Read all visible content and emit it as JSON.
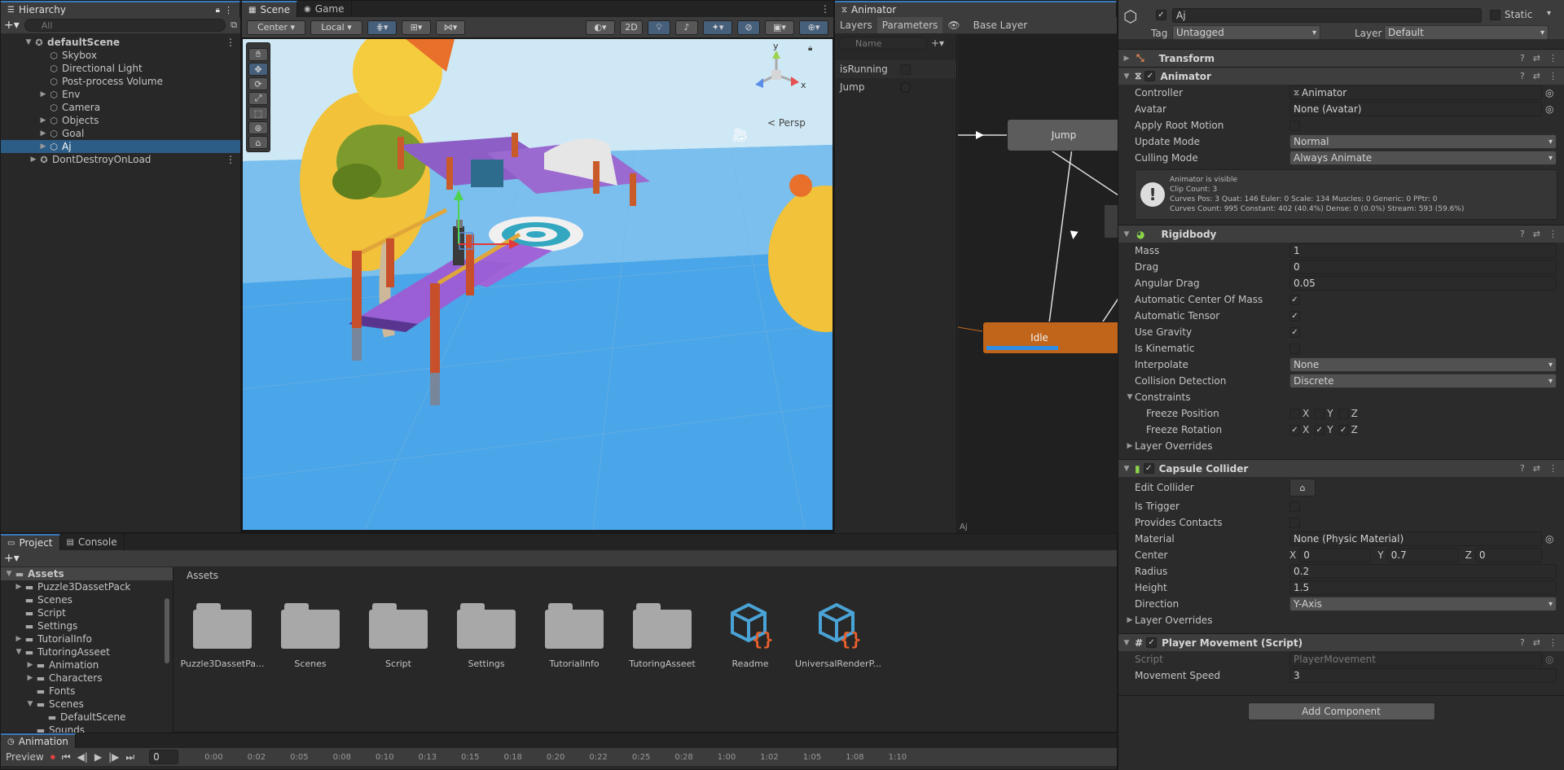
{
  "hierarchy": {
    "tab": "Hierarchy",
    "search_placeholder": "All",
    "items": [
      {
        "label": "defaultScene"
      },
      {
        "label": "Skybox"
      },
      {
        "label": "Directional Light"
      },
      {
        "label": "Post-process Volume"
      },
      {
        "label": "Env"
      },
      {
        "label": "Camera"
      },
      {
        "label": "Objects"
      },
      {
        "label": "Goal"
      },
      {
        "label": "Aj"
      },
      {
        "label": "DontDestroyOnLoad"
      }
    ]
  },
  "scene": {
    "tabs": [
      "Scene",
      "Game"
    ],
    "pivot": "Center",
    "space": "Local",
    "mode_2d": "2D",
    "persp": "< Persp",
    "gizmo_y": "y",
    "gizmo_x": "x"
  },
  "animator": {
    "tab": "Animator",
    "subtabs": [
      "Layers",
      "Parameters"
    ],
    "search_placeholder": "Name",
    "params": [
      {
        "label": "isRunning"
      },
      {
        "label": "Jump"
      }
    ],
    "breadcrumb": "Base Layer",
    "states": {
      "jump": "Jump",
      "idle": "Idle"
    },
    "footer": "Aj"
  },
  "project": {
    "tabs": [
      "Project",
      "Console"
    ],
    "tree": [
      {
        "label": "Assets"
      },
      {
        "label": "Puzzle3DassetPack"
      },
      {
        "label": "Scenes"
      },
      {
        "label": "Script"
      },
      {
        "label": "Settings"
      },
      {
        "label": "TutorialInfo"
      },
      {
        "label": "TutoringAsseet"
      },
      {
        "label": "Animation"
      },
      {
        "label": "Characters"
      },
      {
        "label": "Fonts"
      },
      {
        "label": "Scenes"
      },
      {
        "label": "DefaultScene"
      },
      {
        "label": "Sounds"
      }
    ],
    "breadcrumb": "Assets",
    "assets": [
      {
        "label": "Puzzle3DassetPa...",
        "kind": "folder"
      },
      {
        "label": "Scenes",
        "kind": "folder"
      },
      {
        "label": "Script",
        "kind": "folder"
      },
      {
        "label": "Settings",
        "kind": "folder"
      },
      {
        "label": "TutorialInfo",
        "kind": "folder"
      },
      {
        "label": "TutoringAsseet",
        "kind": "folder"
      },
      {
        "label": "Readme",
        "kind": "asset"
      },
      {
        "label": "UniversalRenderP...",
        "kind": "asset"
      }
    ]
  },
  "animation": {
    "tab": "Animation",
    "preview": "Preview",
    "frame": "0",
    "ticks": [
      "0:00",
      "0:02",
      "0:05",
      "0:08",
      "0:10",
      "0:13",
      "0:15",
      "0:18",
      "0:20",
      "0:22",
      "0:25",
      "0:28",
      "1:00",
      "1:02",
      "1:05",
      "1:08",
      "1:10"
    ]
  },
  "inspector": {
    "name": "Aj",
    "static": "Static",
    "tag_label": "Tag",
    "tag": "Untagged",
    "layer_label": "Layer",
    "layer": "Default",
    "transform": "Transform",
    "animator": {
      "title": "Animator",
      "controller_k": "Controller",
      "controller_v": "Animator",
      "avatar_k": "Avatar",
      "avatar_v": "None (Avatar)",
      "root_k": "Apply Root Motion",
      "update_k": "Update Mode",
      "update_v": "Normal",
      "culling_k": "Culling Mode",
      "culling_v": "Always Animate",
      "info1": "Animator is visible",
      "info2": "Clip Count: 3",
      "info3": "Curves Pos: 3 Quat: 146 Euler: 0 Scale: 134 Muscles: 0 Generic: 0 PPtr: 0",
      "info4": "Curves Count: 995 Constant: 402 (40.4%) Dense: 0 (0.0%) Stream: 593 (59.6%)"
    },
    "rigidbody": {
      "title": "Rigidbody",
      "mass_k": "Mass",
      "mass_v": "1",
      "drag_k": "Drag",
      "drag_v": "0",
      "adrag_k": "Angular Drag",
      "adrag_v": "0.05",
      "acom_k": "Automatic Center Of Mass",
      "aten_k": "Automatic Tensor",
      "grav_k": "Use Gravity",
      "kin_k": "Is Kinematic",
      "interp_k": "Interpolate",
      "interp_v": "None",
      "coll_k": "Collision Detection",
      "coll_v": "Discrete",
      "constraints": "Constraints",
      "fpos_k": "Freeze Position",
      "frot_k": "Freeze Rotation",
      "x": "X",
      "y": "Y",
      "z": "Z",
      "overrides": "Layer Overrides"
    },
    "capsule": {
      "title": "Capsule Collider",
      "edit_k": "Edit Collider",
      "trigger_k": "Is Trigger",
      "contacts_k": "Provides Contacts",
      "material_k": "Material",
      "material_v": "None (Physic Material)",
      "center_k": "Center",
      "cx": "0",
      "cy": "0.7",
      "cz": "0",
      "radius_k": "Radius",
      "radius_v": "0.2",
      "height_k": "Height",
      "height_v": "1.5",
      "dir_k": "Direction",
      "dir_v": "Y-Axis",
      "overrides": "Layer Overrides"
    },
    "script": {
      "title": "Player Movement (Script)",
      "script_k": "Script",
      "script_v": "PlayerMovement",
      "speed_k": "Movement Speed",
      "speed_v": "3"
    },
    "add_component": "Add Component"
  }
}
